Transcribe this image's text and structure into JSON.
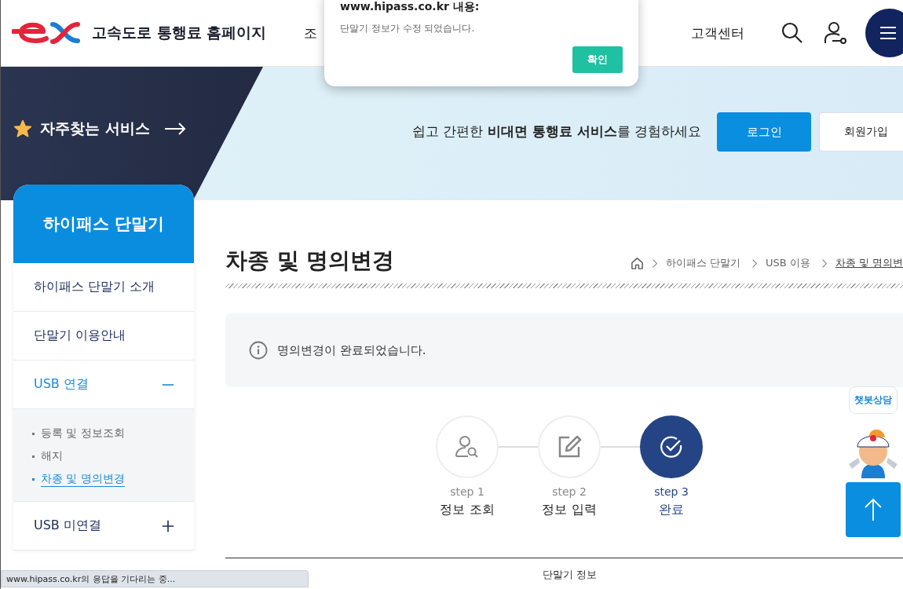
{
  "header": {
    "site_title": "고속도로 통행료 홈페이지",
    "nav": [
      "조",
      "고객센터"
    ]
  },
  "dialog": {
    "title": "www.hipass.co.kr 내용:",
    "message": "단말기 정보가 수정 되었습니다.",
    "button": "확인"
  },
  "banner": {
    "quick_link": "자주찾는 서비스",
    "tagline": "쉽고 간편한 **비대면 통행료 서비스**를 경험하세요",
    "login": "로그인",
    "signup": "회원가입"
  },
  "sidebar": {
    "title": "하이패스 단말기",
    "items": [
      {
        "label": "하이패스 단말기 소개",
        "kind": "link",
        "selected": false
      },
      {
        "label": "단말기 이용안내",
        "kind": "link",
        "selected": false
      },
      {
        "label": "USB 연결",
        "kind": "group",
        "selected": true,
        "expanded": true,
        "children": [
          {
            "label": "등록 및 정보조회",
            "selected": false
          },
          {
            "label": "해지",
            "selected": false
          },
          {
            "label": "차종 및 명의변경",
            "selected": true
          }
        ]
      },
      {
        "label": "USB 미연결",
        "kind": "group",
        "selected": false,
        "expanded": false
      }
    ]
  },
  "page": {
    "title": "차종 및 명의변경",
    "breadcrumb": [
      "하이패스 단말기",
      "USB 이용",
      "차종 및 명의변"
    ],
    "notice": "명의변경이 완료되었습니다.",
    "steps": [
      {
        "step": "step 1",
        "label": "정보 조회",
        "kind": "lookup",
        "selected": false
      },
      {
        "step": "step 2",
        "label": "정보 입력",
        "kind": "edit",
        "selected": false
      },
      {
        "step": "step 3",
        "label": "완료",
        "kind": "done",
        "selected": true
      }
    ],
    "section_heading": "단말기 정보"
  },
  "chatbot": {
    "label": "챗봇상담"
  },
  "status_bar": "www.hipass.co.kr의 응답을 기다리는 중..."
}
